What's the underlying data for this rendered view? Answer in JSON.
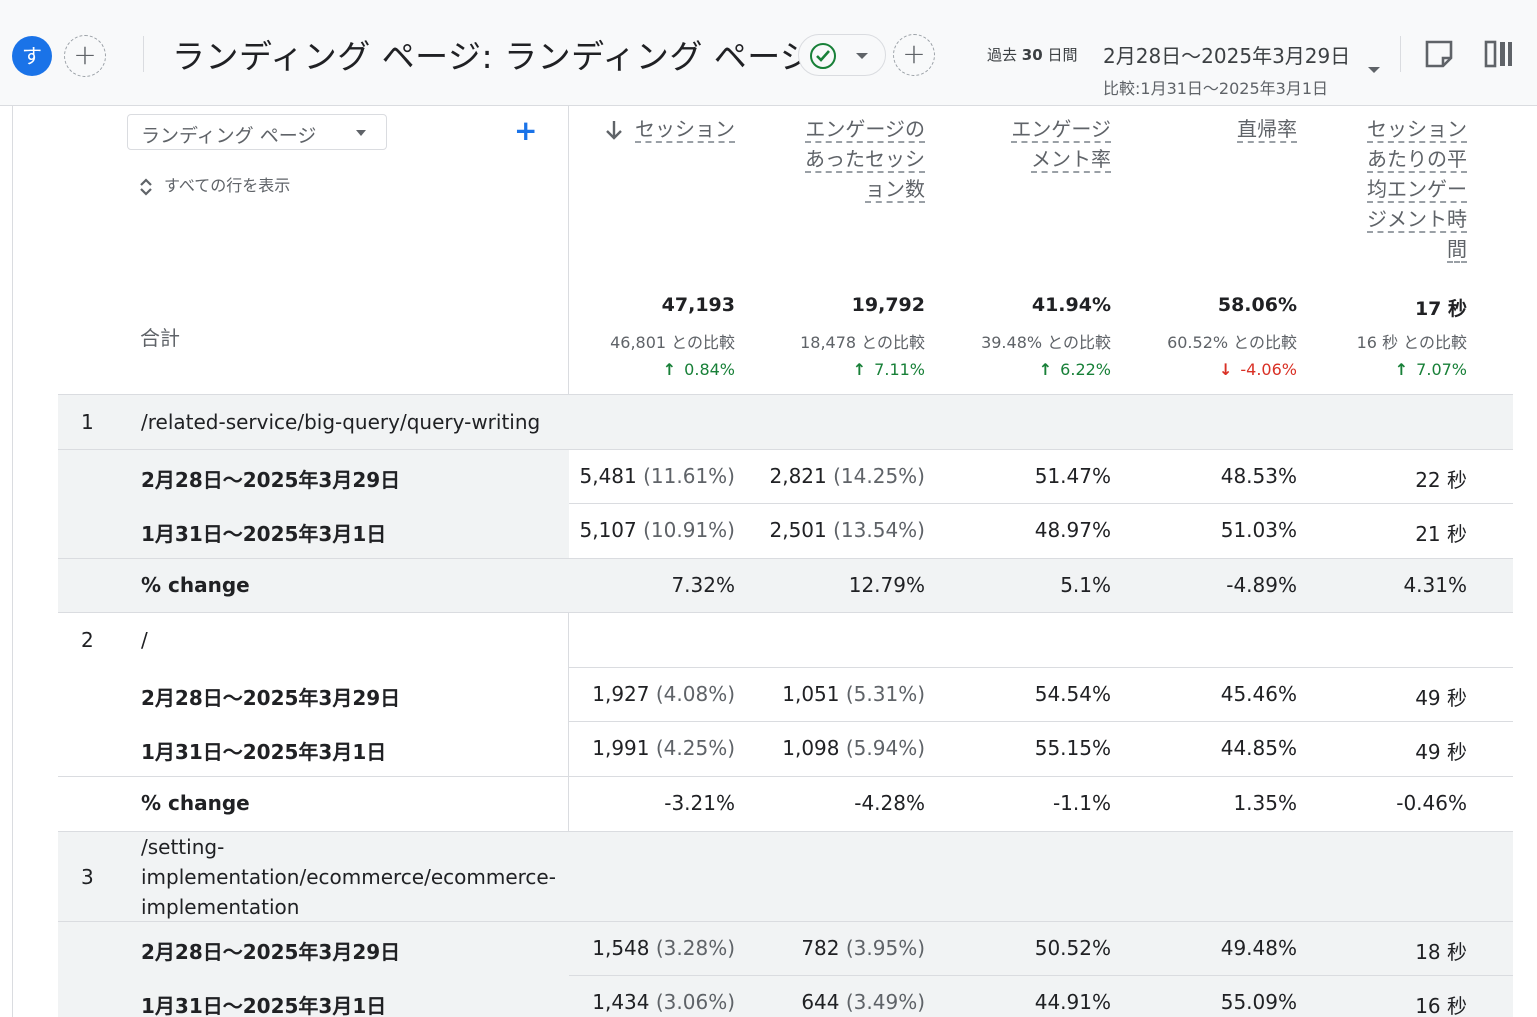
{
  "header": {
    "avatar_letter": "す",
    "add_label": "+",
    "title": "ランディング ページ: ランディング ページ",
    "period_label_prefix": "過去",
    "period_days": "30",
    "period_label_suffix": "日間",
    "date_range": "2月28日〜2025年3月29日",
    "compare_range": "比較:1月31日〜2025年3月1日"
  },
  "toolbar": {
    "dimension_select": "ランディング ページ",
    "add_dimension": "+",
    "show_all_rows": "すべての行を表示"
  },
  "columns": [
    {
      "label_lines": [
        "セッション"
      ],
      "sorted": true
    },
    {
      "label_lines": [
        "エンゲージの",
        "あったセッシ",
        "ョン数"
      ]
    },
    {
      "label_lines": [
        "エンゲージ",
        "メント率"
      ]
    },
    {
      "label_lines": [
        "直帰率"
      ]
    },
    {
      "label_lines": [
        "セッション",
        "あたりの平",
        "均エンゲー",
        "ジメント時",
        "間"
      ]
    }
  ],
  "totals": {
    "label": "合計",
    "values": [
      "47,193",
      "19,792",
      "41.94%",
      "58.06%",
      "17 秒"
    ],
    "compare": [
      "46,801 との比較",
      "18,478 との比較",
      "39.48% との比較",
      "60.52% との比較",
      "16 秒 との比較"
    ],
    "change": [
      "0.84%",
      "7.11%",
      "6.22%",
      "-4.06%",
      "7.07%"
    ],
    "change_dir": [
      "up",
      "up",
      "up",
      "down",
      "up"
    ]
  },
  "rows": [
    {
      "rank": "1",
      "path": "/related-service/big-query/query-writing",
      "current": {
        "label": "2月28日〜2025年3月29日",
        "v1": "5,481",
        "p1": "(11.61%)",
        "v2": "2,821",
        "p2": "(14.25%)",
        "v3": "51.47%",
        "v4": "48.53%",
        "v5": "22 秒"
      },
      "previous": {
        "label": "1月31日〜2025年3月1日",
        "v1": "5,107",
        "p1": "(10.91%)",
        "v2": "2,501",
        "p2": "(13.54%)",
        "v3": "48.97%",
        "v4": "51.03%",
        "v5": "21 秒"
      },
      "change": {
        "label": "% change",
        "v1": "7.32%",
        "v2": "12.79%",
        "v3": "5.1%",
        "v4": "-4.89%",
        "v5": "4.31%"
      }
    },
    {
      "rank": "2",
      "path": "/",
      "current": {
        "label": "2月28日〜2025年3月29日",
        "v1": "1,927",
        "p1": "(4.08%)",
        "v2": "1,051",
        "p2": "(5.31%)",
        "v3": "54.54%",
        "v4": "45.46%",
        "v5": "49 秒"
      },
      "previous": {
        "label": "1月31日〜2025年3月1日",
        "v1": "1,991",
        "p1": "(4.25%)",
        "v2": "1,098",
        "p2": "(5.94%)",
        "v3": "55.15%",
        "v4": "44.85%",
        "v5": "49 秒"
      },
      "change": {
        "label": "% change",
        "v1": "-3.21%",
        "v2": "-4.28%",
        "v3": "-1.1%",
        "v4": "1.35%",
        "v5": "-0.46%"
      }
    },
    {
      "rank": "3",
      "path_lines": [
        "/setting-",
        "implementation/ecommerce/ecommerce-",
        "implementation"
      ],
      "current": {
        "label": "2月28日〜2025年3月29日",
        "v1": "1,548",
        "p1": "(3.28%)",
        "v2": "782",
        "p2": "(3.95%)",
        "v3": "50.52%",
        "v4": "49.48%",
        "v5": "18 秒"
      },
      "previous": {
        "label": "1月31日〜2025年3月1日",
        "v1": "1,434",
        "p1": "(3.06%)",
        "v2": "644",
        "p2": "(3.49%)",
        "v3": "44.91%",
        "v4": "55.09%",
        "v5": "16 秒"
      }
    }
  ]
}
